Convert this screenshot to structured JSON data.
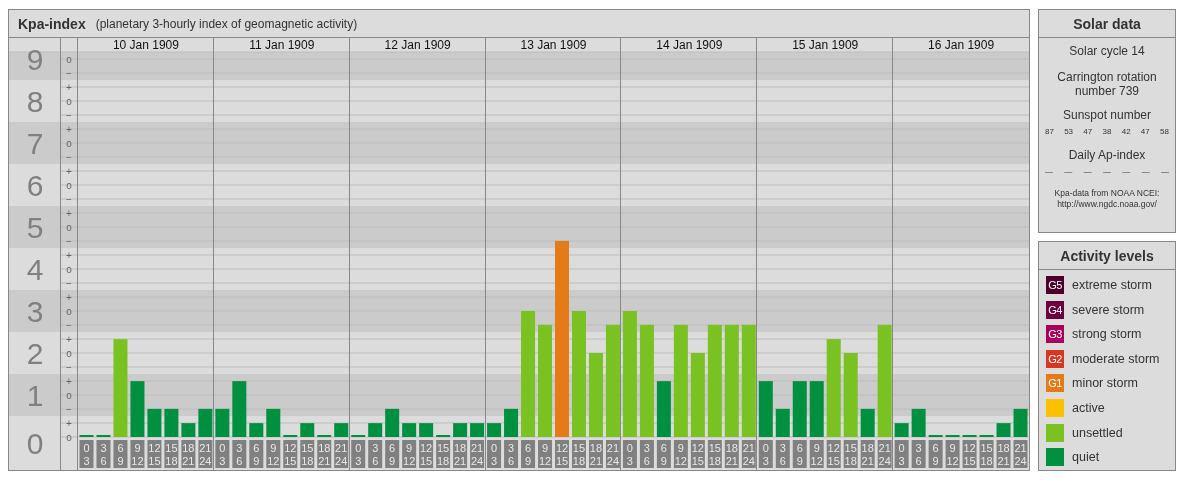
{
  "kp_panel": {
    "title": "Kpa-index",
    "subtitle": "(planetary 3-hourly index of geomagnetic activity)",
    "days": [
      "10 Jan 1909",
      "11 Jan 1909",
      "12 Jan 1909",
      "13 Jan 1909",
      "14 Jan 1909",
      "15 Jan 1909",
      "16 Jan 1909"
    ],
    "chart_data": {
      "type": "bar",
      "ylim": [
        0,
        9
      ],
      "grid": true,
      "yticks": [
        0,
        1,
        2,
        3,
        4,
        5,
        6,
        7,
        8,
        9
      ],
      "annotations": [
        "o",
        "−",
        "+",
        "o",
        "−",
        "+",
        "o",
        "−",
        "+",
        "o",
        "−",
        "+",
        "o",
        "−",
        "+",
        "o",
        "−",
        "+",
        "o",
        "−",
        "+",
        "o",
        "−",
        "+",
        "o",
        "−",
        "+",
        "o"
      ],
      "categories": [
        "0\n3",
        "3\n6",
        "6\n9",
        "9\n12",
        "12\n15",
        "15\n18",
        "18\n21",
        "21\n24",
        "0\n3",
        "3\n6",
        "6\n9",
        "9\n12",
        "12\n15",
        "15\n18",
        "18\n21",
        "21\n24",
        "0\n3",
        "3\n6",
        "6\n9",
        "9\n12",
        "12\n15",
        "15\n18",
        "18\n21",
        "21\n24",
        "0\n3",
        "3\n6",
        "6\n9",
        "9\n12",
        "12\n15",
        "15\n18",
        "18\n21",
        "21\n24",
        "0\n3",
        "3\n6",
        "6\n9",
        "9\n12",
        "12\n15",
        "15\n18",
        "18\n21",
        "21\n24",
        "0\n3",
        "3\n6",
        "6\n9",
        "9\n12",
        "12\n15",
        "15\n18",
        "18\n21",
        "21\n24",
        "0\n3",
        "3\n6",
        "6\n9",
        "9\n12",
        "12\n15",
        "15\n18",
        "18\n21",
        "21\n24"
      ],
      "series": [
        {
          "color": "#00903f",
          "values": [
            0,
            0,
            null,
            1.33,
            0.67,
            0.67,
            0.33,
            0.67,
            0.67,
            1.33,
            0.33,
            0.67,
            0,
            0.33,
            0,
            0.33,
            0,
            0.33,
            0.67,
            0.33,
            0.33,
            0,
            0.33,
            0.33,
            0.33,
            0.67,
            null,
            null,
            null,
            null,
            null,
            null,
            null,
            null,
            1.33,
            null,
            null,
            null,
            null,
            null,
            1.33,
            0.67,
            1.33,
            1.33,
            null,
            null,
            0.67,
            null,
            0.33,
            0.67,
            0,
            0,
            0,
            0,
            0.33,
            0.67
          ]
        },
        {
          "color": "#7ac122",
          "values": [
            null,
            null,
            2.33,
            null,
            null,
            null,
            null,
            null,
            null,
            null,
            null,
            null,
            null,
            null,
            null,
            null,
            null,
            null,
            null,
            null,
            null,
            null,
            null,
            null,
            null,
            null,
            3,
            2.67,
            null,
            3,
            2,
            2.67,
            3,
            2.67,
            null,
            2.67,
            2,
            2.67,
            2.67,
            2.67,
            null,
            null,
            null,
            null,
            2.33,
            2,
            null,
            2.67,
            null,
            null,
            null,
            null,
            null,
            null,
            null,
            null
          ]
        },
        {
          "color": "#e57a18",
          "values": [
            null,
            null,
            null,
            null,
            null,
            null,
            null,
            null,
            null,
            null,
            null,
            null,
            null,
            null,
            null,
            null,
            null,
            null,
            null,
            null,
            null,
            null,
            null,
            null,
            null,
            null,
            null,
            null,
            4.67,
            null,
            null,
            null,
            null,
            null,
            null,
            null,
            null,
            null,
            null,
            null,
            null,
            null,
            null,
            null,
            null,
            null,
            null,
            null,
            null,
            null,
            null,
            null,
            null,
            null,
            null,
            null
          ]
        }
      ]
    }
  },
  "solar_data": {
    "title": "Solar data",
    "solar_cycle": "Solar cycle 14",
    "carrington": "Carrington rotation number 739",
    "sunspot_label": "Sunspot number",
    "sunspot_numbers": [
      "87",
      "53",
      "47",
      "38",
      "42",
      "47",
      "58"
    ],
    "ap_label": "Daily Ap-index",
    "ap_values": [
      "—",
      "—",
      "—",
      "—",
      "—",
      "—",
      "—"
    ],
    "source": "Kpa-data from NOAA NCEI:",
    "source_url": "http://www.ngdc.noaa.gov/"
  },
  "activity_levels": {
    "title": "Activity levels",
    "items": [
      {
        "badge": "G5",
        "label": "extreme storm",
        "color": "#4d0029"
      },
      {
        "badge": "G4",
        "label": "severe storm",
        "color": "#6c0040"
      },
      {
        "badge": "G3",
        "label": "strong storm",
        "color": "#a8005c"
      },
      {
        "badge": "G2",
        "label": "moderate storm",
        "color": "#d93622"
      },
      {
        "badge": "G1",
        "label": "minor storm",
        "color": "#e57a18"
      },
      {
        "label": "active",
        "color": "#f9c100"
      },
      {
        "label": "unsettled",
        "color": "#7ac122"
      },
      {
        "label": "quiet",
        "color": "#00903f"
      }
    ]
  }
}
